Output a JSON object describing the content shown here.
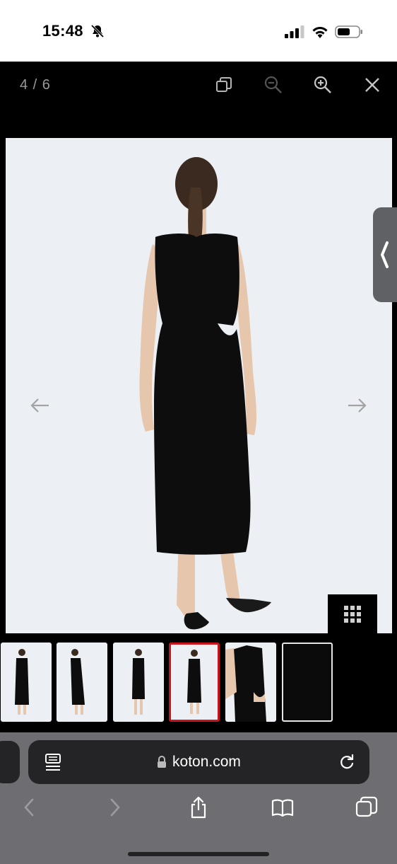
{
  "status_bar": {
    "time": "15:48",
    "icons": [
      "bell-slash-icon",
      "cellular-signal-icon",
      "wifi-icon",
      "battery-icon"
    ]
  },
  "viewer": {
    "counter": "4 / 6",
    "tools": [
      "fullscreen-icon",
      "zoom-out-icon",
      "zoom-in-icon",
      "close-icon"
    ]
  },
  "gallery": {
    "current_index": 4,
    "total": 6,
    "thumbnails": [
      "thumbnail-1",
      "thumbnail-2",
      "thumbnail-3",
      "thumbnail-4",
      "thumbnail-5",
      "thumbnail-6"
    ],
    "active_border_color": "#c8141c"
  },
  "browser": {
    "url": "koton.com"
  }
}
